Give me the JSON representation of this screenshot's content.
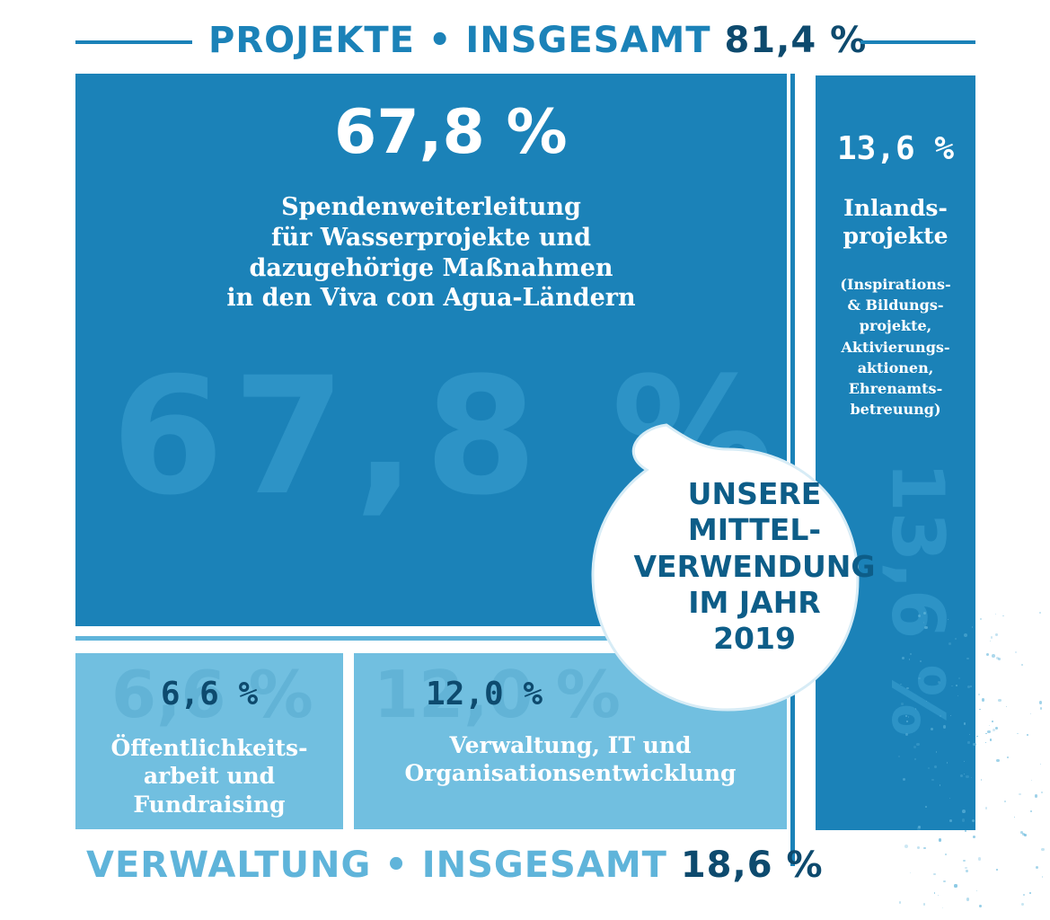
{
  "header": {
    "label": "PROJEKTE • INSGESAMT",
    "total": "81,4 %"
  },
  "footer": {
    "label": "VERWALTUNG • INSGESAMT",
    "total": "18,6 %"
  },
  "badge": {
    "lines": [
      "UNSERE",
      "MITTEL-",
      "VERWENDUNG",
      "IM JAHR",
      "2019"
    ]
  },
  "segments": [
    {
      "value_text": "67,8 %",
      "label_lines": [
        "Spendenweiterleitung",
        "für Wasserprojekte und",
        "dazugehörige Maßnahmen",
        "in den Viva con Agua-Ländern"
      ]
    },
    {
      "value_text": "13,6 %",
      "label_lines": [
        "Inlands-",
        "projekte"
      ],
      "note_lines": [
        "(Inspirations-",
        "& Bildungs-",
        "projekte,",
        "Aktivierungs-",
        "aktionen,",
        "Ehrenamts-",
        "betreuung)"
      ]
    },
    {
      "value_text": "6,6 %",
      "label_lines": [
        "Öffentlichkeits-",
        "arbeit und",
        "Fundraising"
      ]
    },
    {
      "value_text": "12,0 %",
      "label_lines": [
        "Verwaltung, IT und",
        "Organisationsentwicklung"
      ]
    }
  ],
  "chart_data": {
    "type": "treemap",
    "groups": [
      {
        "name": "PROJEKTE • INSGESAMT",
        "value": 81.4
      },
      {
        "name": "VERWALTUNG • INSGESAMT",
        "value": 18.6
      }
    ],
    "categories": [
      "Spendenweiterleitung für Wasserprojekte und dazugehörige Maßnahmen in den Viva con Agua-Ländern",
      "Inlandsprojekte",
      "Öffentlichkeitsarbeit und Fundraising",
      "Verwaltung, IT und Organisationsentwicklung"
    ],
    "values": [
      67.8,
      13.6,
      6.6,
      12.0
    ],
    "group_of": [
      "PROJEKTE • INSGESAMT",
      "PROJEKTE • INSGESAMT",
      "VERWALTUNG • INSGESAMT",
      "VERWALTUNG • INSGESAMT"
    ],
    "unit": "%",
    "colors": {
      "projects": "#1b82b8",
      "admin": "#71bfe0",
      "value_text": "#0d4a6e",
      "label_text": "#ffffff"
    }
  }
}
